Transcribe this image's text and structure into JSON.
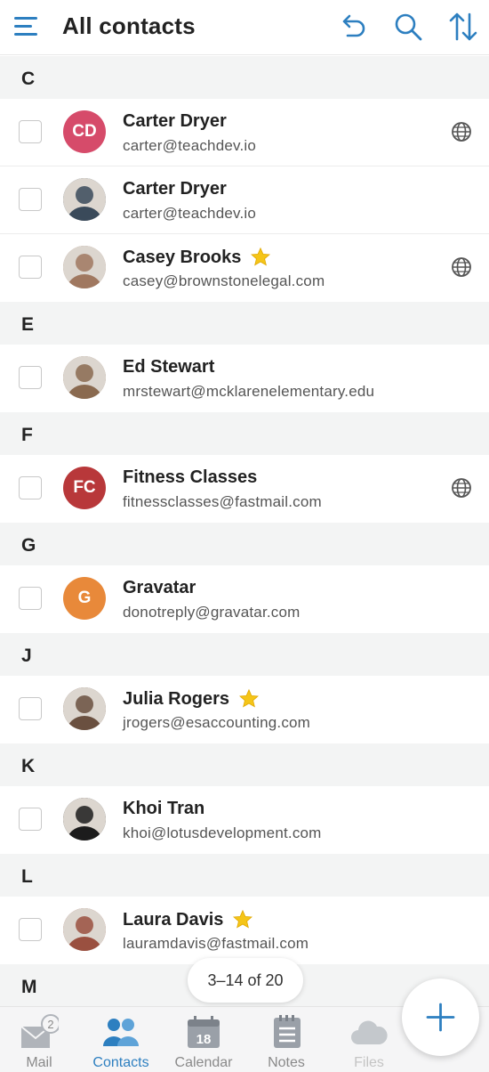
{
  "header": {
    "title": "All contacts"
  },
  "sections": [
    {
      "letter": "C",
      "contacts": [
        {
          "name": "Carter Dryer",
          "email": "carter@teachdev.io",
          "initials": "CD",
          "avatar_color": "#d64b6a",
          "photo": false,
          "starred": false,
          "globe": true
        },
        {
          "name": "Carter Dryer",
          "email": "carter@teachdev.io",
          "initials": "",
          "avatar_color": "#3a4a5a",
          "photo": true,
          "starred": false,
          "globe": false
        },
        {
          "name": "Casey Brooks",
          "email": "casey@brownstonelegal.com",
          "initials": "",
          "avatar_color": "#a07860",
          "photo": true,
          "starred": true,
          "globe": true
        }
      ]
    },
    {
      "letter": "E",
      "contacts": [
        {
          "name": "Ed Stewart",
          "email": "mrstewart@mcklarenelementary.edu",
          "initials": "",
          "avatar_color": "#8a6a50",
          "photo": true,
          "starred": false,
          "globe": false
        }
      ]
    },
    {
      "letter": "F",
      "contacts": [
        {
          "name": "Fitness Classes",
          "email": "fitnessclasses@fastmail.com",
          "initials": "FC",
          "avatar_color": "#b8383a",
          "photo": false,
          "starred": false,
          "globe": true
        }
      ]
    },
    {
      "letter": "G",
      "contacts": [
        {
          "name": "Gravatar",
          "email": "donotreply@gravatar.com",
          "initials": "G",
          "avatar_color": "#e8893a",
          "photo": false,
          "starred": false,
          "globe": false
        }
      ]
    },
    {
      "letter": "J",
      "contacts": [
        {
          "name": "Julia Rogers",
          "email": "jrogers@esaccounting.com",
          "initials": "",
          "avatar_color": "#6a5040",
          "photo": true,
          "starred": true,
          "globe": false
        }
      ]
    },
    {
      "letter": "K",
      "contacts": [
        {
          "name": "Khoi Tran",
          "email": "khoi@lotusdevelopment.com",
          "initials": "",
          "avatar_color": "#1c1c1c",
          "photo": true,
          "starred": false,
          "globe": false
        }
      ]
    },
    {
      "letter": "L",
      "contacts": [
        {
          "name": "Laura Davis",
          "email": "lauramdavis@fastmail.com",
          "initials": "",
          "avatar_color": "#9a5040",
          "photo": true,
          "starred": true,
          "globe": false
        }
      ]
    },
    {
      "letter": "M",
      "contacts": []
    }
  ],
  "pager": {
    "text": "3–14 of 20"
  },
  "nav": {
    "mail_label": "Mail",
    "mail_badge": "2",
    "contacts_label": "Contacts",
    "calendar_label": "Calendar",
    "calendar_day": "18",
    "notes_label": "Notes",
    "files_label": "Files"
  },
  "colors": {
    "accent": "#2d7fc0",
    "star": "#f5c518",
    "section_bg": "#f3f4f4"
  }
}
